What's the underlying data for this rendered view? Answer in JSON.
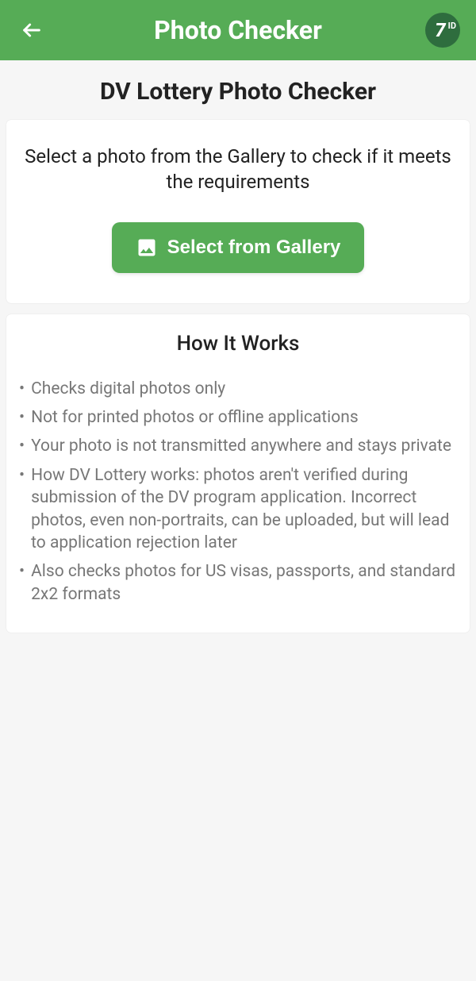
{
  "header": {
    "title": "Photo Checker",
    "logo_seven": "7",
    "logo_id": "ID"
  },
  "page_title": "DV Lottery Photo Checker",
  "select": {
    "prompt": "Select a photo from the Gallery to check if it meets the requirements",
    "button_label": "Select from Gallery"
  },
  "how": {
    "title": "How It Works",
    "items": [
      "Checks digital photos only",
      "Not for printed photos or offline applications",
      "Your photo is not transmitted anywhere and stays private",
      "How DV Lottery works: photos aren't verified during submission of the DV program application. Incorrect photos, even non-portraits, can be uploaded, but will lead to application rejection later",
      "Also checks photos for US visas, passports, and standard 2x2 formats"
    ]
  }
}
